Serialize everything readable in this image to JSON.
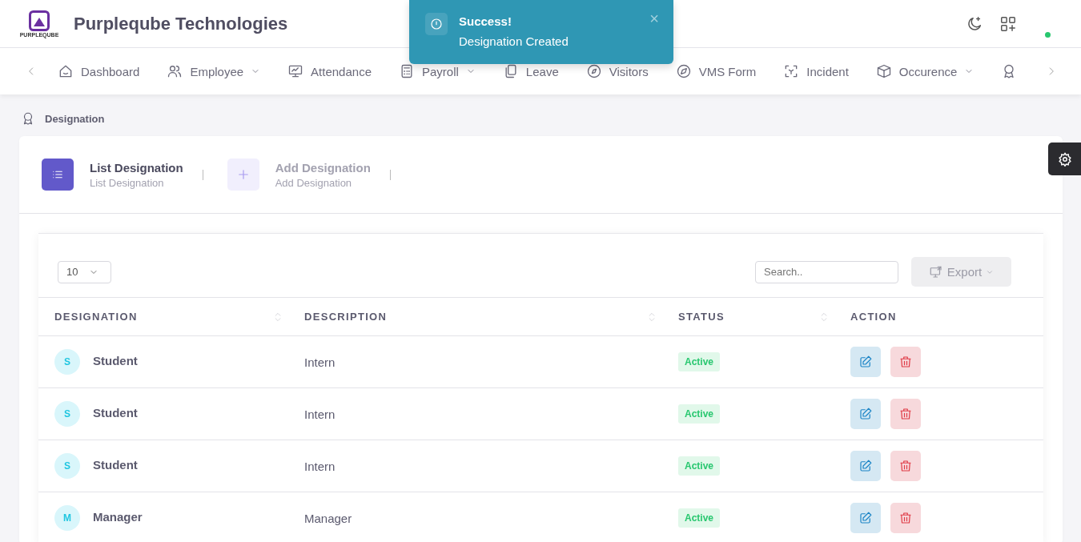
{
  "header": {
    "logo_text": "PURPLEQUBE",
    "company": "Purpleqube Technologies",
    "online": true
  },
  "toast": {
    "title": "Success!",
    "message": "Designation Created",
    "close": "×"
  },
  "nav": {
    "items": [
      {
        "label": "Dashboard",
        "has_menu": false
      },
      {
        "label": "Employee",
        "has_menu": true
      },
      {
        "label": "Attendance",
        "has_menu": false
      },
      {
        "label": "Payroll",
        "has_menu": true
      },
      {
        "label": "Leave",
        "has_menu": false
      },
      {
        "label": "Visitors",
        "has_menu": false
      },
      {
        "label": "VMS Form",
        "has_menu": false
      },
      {
        "label": "Incident",
        "has_menu": false
      },
      {
        "label": "Occurence",
        "has_menu": true
      },
      {
        "has_menu": false
      }
    ]
  },
  "breadcrumb": "Designation",
  "tabs": [
    {
      "title": "List Designation",
      "subtitle": "List Designation",
      "selected": true
    },
    {
      "title": "Add Designation",
      "subtitle": "Add Designation",
      "selected": false
    }
  ],
  "table": {
    "page_size": "10",
    "search": {
      "placeholder": "Search.."
    },
    "export": {
      "label": "Export",
      "disabled": true
    },
    "columns": [
      {
        "label": "DESIGNATION",
        "sortable": true
      },
      {
        "label": "DESCRIPTION",
        "sortable": true
      },
      {
        "label": "STATUS",
        "sortable": true
      },
      {
        "label": "ACTION",
        "sortable": false
      }
    ],
    "rows": [
      {
        "initial": "S",
        "designation": "Student",
        "description": "Intern",
        "status": "Active"
      },
      {
        "initial": "S",
        "designation": "Student",
        "description": "Intern",
        "status": "Active"
      },
      {
        "initial": "S",
        "designation": "Student",
        "description": "Intern",
        "status": "Active"
      },
      {
        "initial": "M",
        "designation": "Manager",
        "description": "Manager",
        "status": "Active"
      }
    ]
  }
}
